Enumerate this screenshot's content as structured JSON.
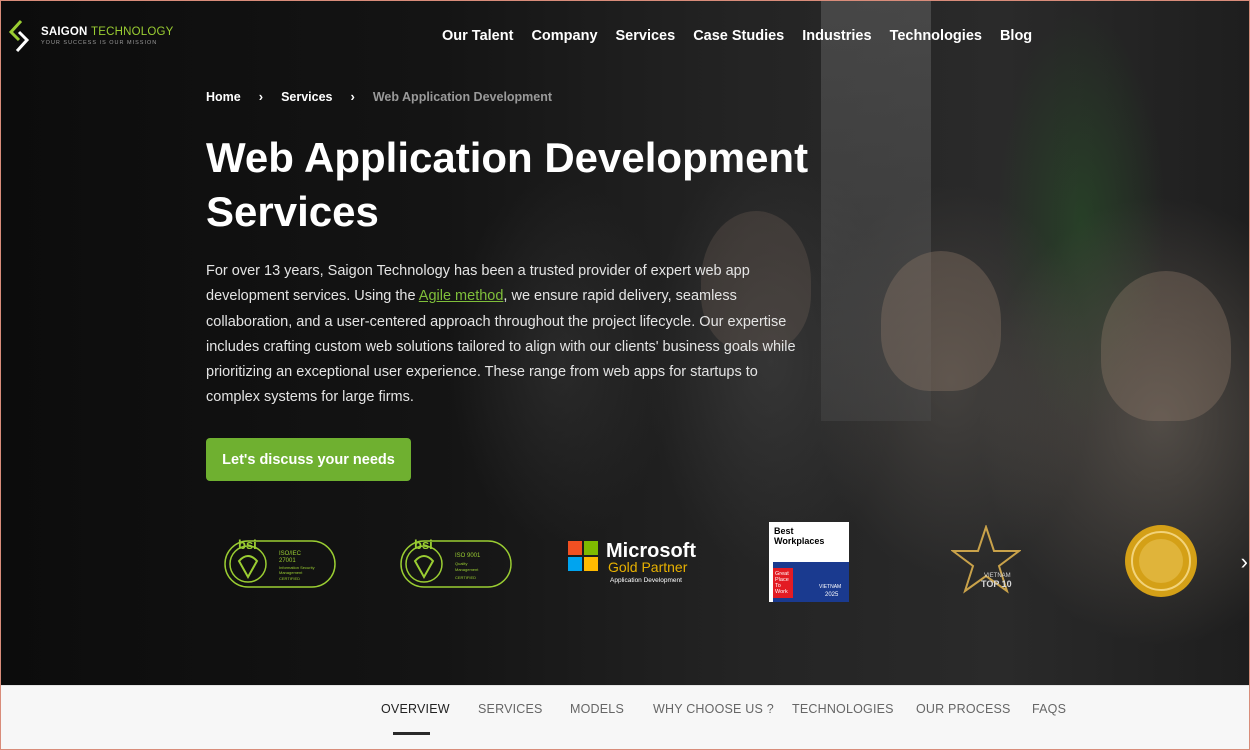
{
  "brand": {
    "name_part1": "SAIGON",
    "name_part2": "TECHNOLOGY",
    "tagline": "YOUR SUCCESS IS OUR MISSION"
  },
  "nav": {
    "items": [
      {
        "label": "Our Talent"
      },
      {
        "label": "Company"
      },
      {
        "label": "Services"
      },
      {
        "label": "Case Studies"
      },
      {
        "label": "Industries"
      },
      {
        "label": "Technologies"
      },
      {
        "label": "Blog"
      }
    ]
  },
  "breadcrumb": {
    "home": "Home",
    "services": "Services",
    "current": "Web Application Development"
  },
  "hero": {
    "title_line1": "Web Application Development",
    "title_line2": "Services",
    "desc_before": "For over 13 years, Saigon Technology has been a trusted provider of expert web app development services. Using the ",
    "desc_link": "Agile method",
    "desc_after": ", we ensure rapid delivery, seamless collaboration, and a user-centered approach throughout the project lifecycle. Our expertise includes crafting custom web solutions tailored to align with our clients' business goals while prioritizing an exceptional user experience. These range from web apps for startups to complex systems for large firms.",
    "cta_label": "Let's discuss your needs"
  },
  "badges": {
    "bsi1": {
      "brand": "bsi",
      "line1": "ISO/IEC",
      "line2": "27001",
      "line3": "Information Security",
      "line4": "Management",
      "line5": "CERTIFIED"
    },
    "bsi2": {
      "brand": "bsi",
      "line1": "ISO 9001",
      "line2": "Quality",
      "line3": "Management",
      "line4": "CERTIFIED"
    },
    "microsoft": {
      "name": "Microsoft",
      "partner": "Gold Partner",
      "sub": "Application Development"
    },
    "gptw": {
      "top1": "Best",
      "top2": "Workplaces",
      "g1": "Great",
      "g2": "Place",
      "g3": "To",
      "g4": "Work",
      "country": "VIETNAM",
      "year": "2025"
    },
    "top10": {
      "line1": "VIETNAM",
      "line2": "TOP 10"
    }
  },
  "tabs": {
    "items": [
      {
        "label": "OVERVIEW"
      },
      {
        "label": "SERVICES"
      },
      {
        "label": "MODELS"
      },
      {
        "label": "WHY CHOOSE US ?"
      },
      {
        "label": "TECHNOLOGIES"
      },
      {
        "label": "OUR PROCESS"
      },
      {
        "label": "FAQS"
      }
    ],
    "active_index": 0
  },
  "colors": {
    "accent_green": "#6fb030",
    "link_green": "#7fbf3a",
    "logo_green": "#9acd32",
    "gold": "#d4a017"
  }
}
